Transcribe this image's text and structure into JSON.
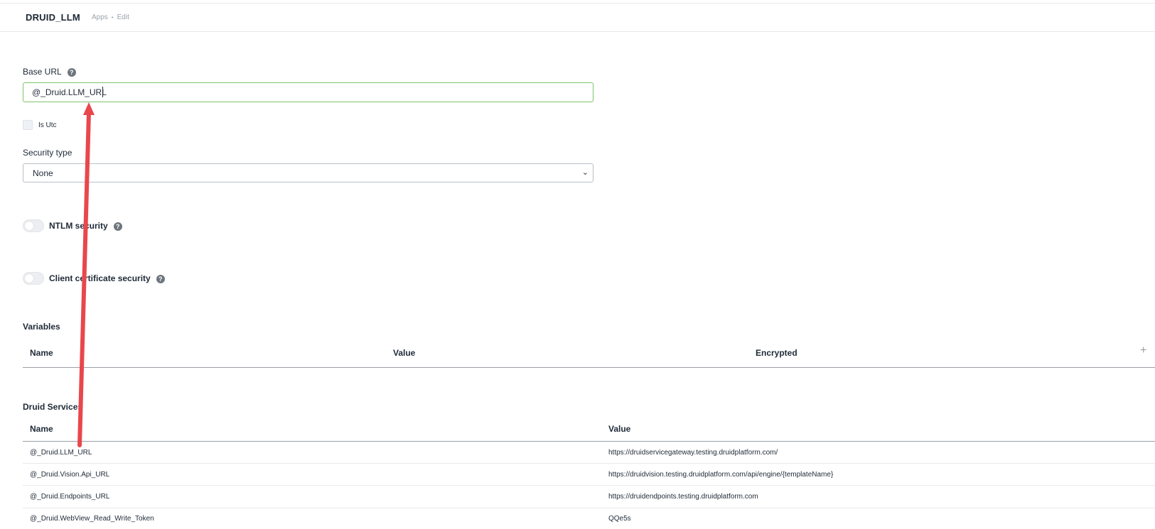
{
  "header": {
    "app_title": "DRUID_LLM",
    "breadcrumb": [
      "Apps",
      "Edit"
    ]
  },
  "base_url": {
    "label": "Base URL",
    "value": "@_Druid.LLM_URL"
  },
  "is_utc": {
    "label": "Is Utc",
    "checked": false
  },
  "security_type": {
    "label": "Security type",
    "selected": "None"
  },
  "ntlm": {
    "label": "NTLM security",
    "enabled": false
  },
  "client_cert": {
    "label": "Client certificate security",
    "enabled": false
  },
  "variables": {
    "title": "Variables",
    "columns": [
      "Name",
      "Value",
      "Encrypted"
    ]
  },
  "druid_services": {
    "title": "Druid Services",
    "columns": [
      "Name",
      "Value"
    ],
    "rows": [
      {
        "name": "@_Druid.LLM_URL",
        "value": "https://druidservicegateway.testing.druidplatform.com/"
      },
      {
        "name": "@_Druid.Vision.Api_URL",
        "value": "https://druidvision.testing.druidplatform.com/api/engine/{templateName}"
      },
      {
        "name": "@_Druid.Endpoints_URL",
        "value": "https://druidendpoints.testing.druidplatform.com"
      },
      {
        "name": "@_Druid.WebView_Read_Write_Token",
        "value": "QQe5s"
      }
    ]
  },
  "colors": {
    "input_focus_border": "#7cc36a",
    "annotation_arrow": "#e8474c",
    "help_icon": "#6e757d"
  }
}
